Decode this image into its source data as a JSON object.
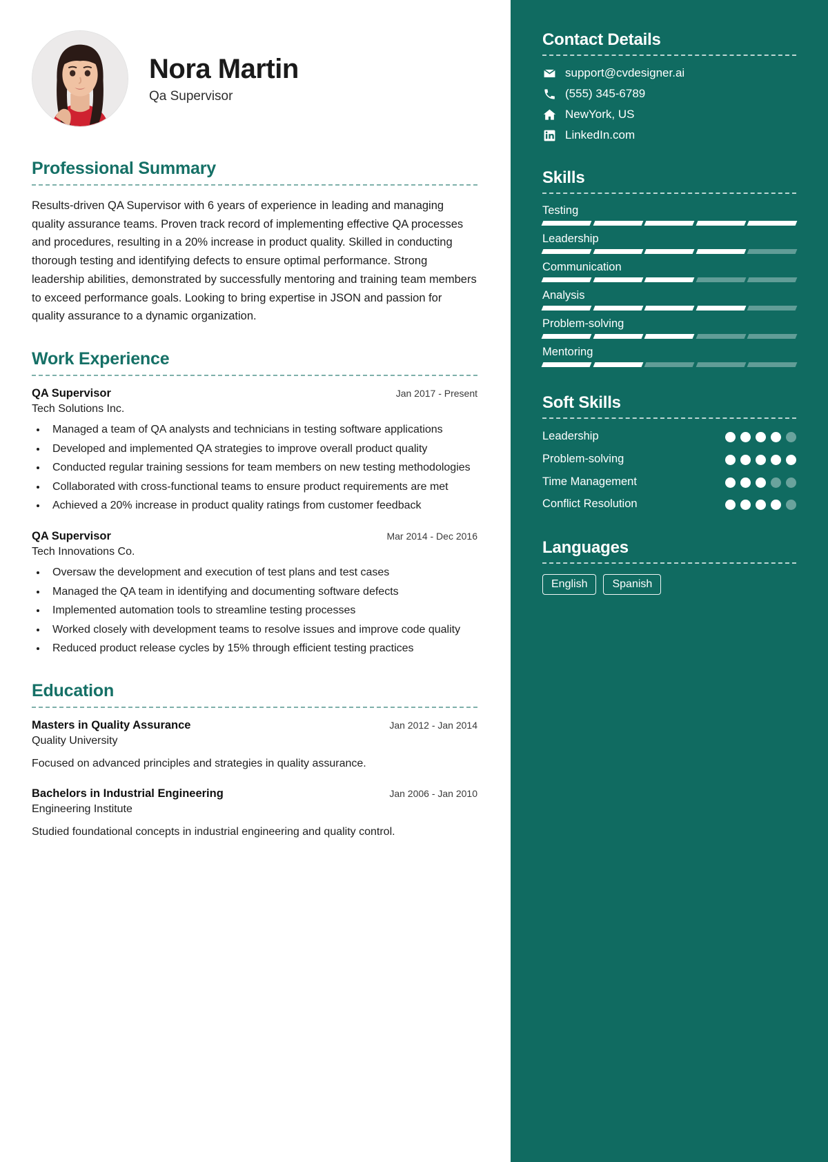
{
  "profile": {
    "name": "Nora Martin",
    "role": "Qa Supervisor",
    "avatar_alt": "profile-photo"
  },
  "summary": {
    "title": "Professional Summary",
    "text": "Results-driven QA Supervisor with 6 years of experience in leading and managing quality assurance teams. Proven track record of implementing effective QA processes and procedures, resulting in a 20% increase in product quality. Skilled in conducting thorough testing and identifying defects to ensure optimal performance. Strong leadership abilities, demonstrated by successfully mentoring and training team members to exceed performance goals. Looking to bring expertise in JSON and passion for quality assurance to a dynamic organization."
  },
  "work": {
    "title": "Work Experience",
    "jobs": [
      {
        "title": "QA Supervisor",
        "date": "Jan 2017 - Present",
        "company": "Tech Solutions Inc.",
        "bullets": [
          "Managed a team of QA analysts and technicians in testing software applications",
          "Developed and implemented QA strategies to improve overall product quality",
          "Conducted regular training sessions for team members on new testing methodologies",
          "Collaborated with cross-functional teams to ensure product requirements are met",
          "Achieved a 20% increase in product quality ratings from customer feedback"
        ]
      },
      {
        "title": "QA Supervisor",
        "date": "Mar 2014 - Dec 2016",
        "company": "Tech Innovations Co.",
        "bullets": [
          "Oversaw the development and execution of test plans and test cases",
          "Managed the QA team in identifying and documenting software defects",
          "Implemented automation tools to streamline testing processes",
          "Worked closely with development teams to resolve issues and improve code quality",
          "Reduced product release cycles by 15% through efficient testing practices"
        ]
      }
    ]
  },
  "education": {
    "title": "Education",
    "items": [
      {
        "degree": "Masters in Quality Assurance",
        "date": "Jan 2012 - Jan 2014",
        "school": "Quality University",
        "description": "Focused on advanced principles and strategies in quality assurance."
      },
      {
        "degree": "Bachelors in Industrial Engineering",
        "date": "Jan 2006 - Jan 2010",
        "school": "Engineering Institute",
        "description": "Studied foundational concepts in industrial engineering and quality control."
      }
    ]
  },
  "contact": {
    "title": "Contact Details",
    "items": [
      {
        "icon": "envelope-icon",
        "value": "support@cvdesigner.ai"
      },
      {
        "icon": "phone-icon",
        "value": "(555) 345-6789"
      },
      {
        "icon": "home-icon",
        "value": "NewYork, US"
      },
      {
        "icon": "linkedin-icon",
        "value": "LinkedIn.com"
      }
    ]
  },
  "skills": {
    "title": "Skills",
    "max": 5,
    "items": [
      {
        "name": "Testing",
        "level": 5
      },
      {
        "name": "Leadership",
        "level": 4
      },
      {
        "name": "Communication",
        "level": 3
      },
      {
        "name": "Analysis",
        "level": 4
      },
      {
        "name": "Problem-solving",
        "level": 3
      },
      {
        "name": "Mentoring",
        "level": 2
      }
    ]
  },
  "soft_skills": {
    "title": "Soft Skills",
    "max": 5,
    "items": [
      {
        "name": "Leadership",
        "level": 4
      },
      {
        "name": "Problem-solving",
        "level": 5
      },
      {
        "name": "Time Management",
        "level": 3
      },
      {
        "name": "Conflict Resolution",
        "level": 4
      }
    ]
  },
  "languages": {
    "title": "Languages",
    "items": [
      "English",
      "Spanish"
    ]
  },
  "colors": {
    "accent": "#157066",
    "sidebar_bg": "#106b61",
    "text": "#1e1e1e"
  }
}
